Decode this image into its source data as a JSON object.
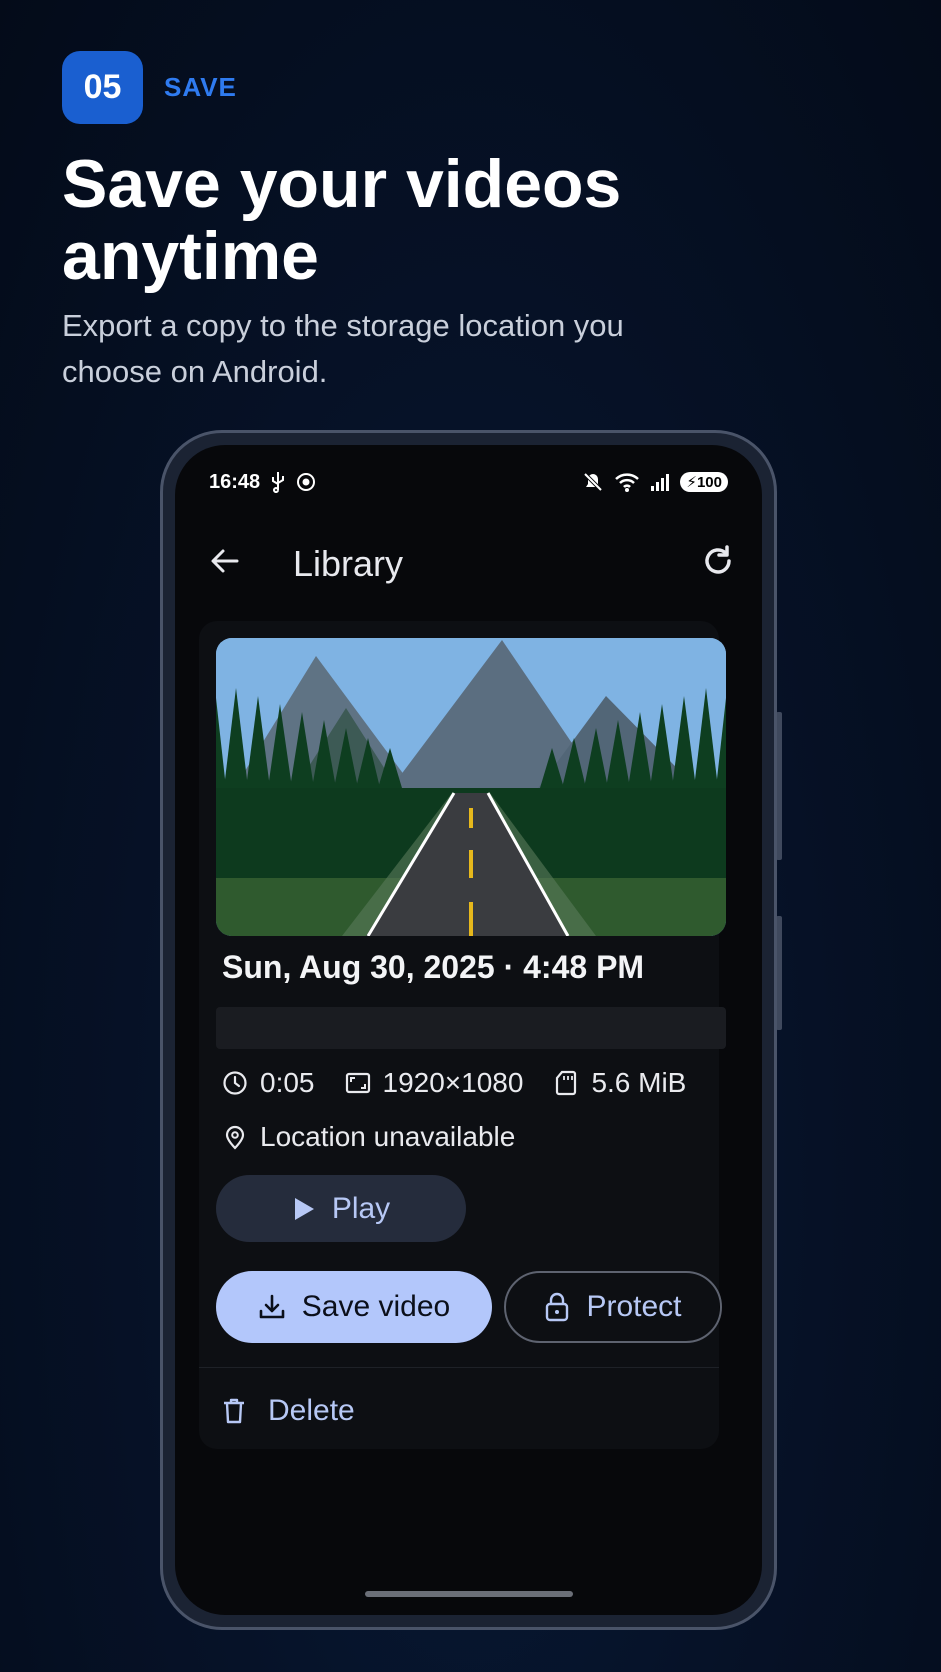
{
  "step": {
    "number": "05",
    "label": "SAVE"
  },
  "headline": "Save your videos anytime",
  "subhead": "Export a copy to the storage location you choose on Android.",
  "statusbar": {
    "time": "16:48",
    "battery": "100"
  },
  "appbar": {
    "title": "Library"
  },
  "video": {
    "date": "Sun, Aug 30, 2025 · 4:48 PM",
    "duration": "0:05",
    "resolution": "1920×1080",
    "size": "5.6 MiB",
    "location": "Location unavailable"
  },
  "actions": {
    "play": "Play",
    "save": "Save video",
    "protect": "Protect",
    "delete": "Delete"
  }
}
